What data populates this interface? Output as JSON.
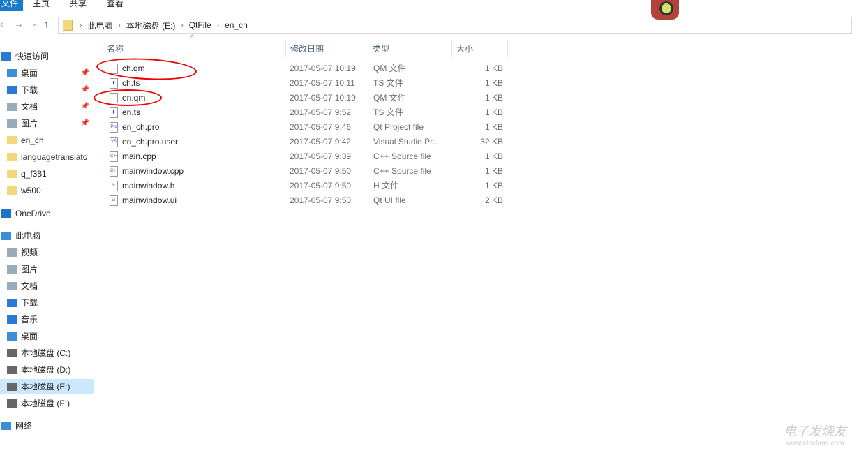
{
  "ribbon": {
    "tabs": [
      "文件",
      "主页",
      "共享",
      "查看"
    ]
  },
  "address": {
    "crumbs": [
      "此电脑",
      "本地磁盘 (E:)",
      "QtFile",
      "en_ch"
    ]
  },
  "sidebar": {
    "items": [
      {
        "label": "快速访问",
        "icon": "star-icon"
      },
      {
        "label": "桌面",
        "icon": "desktop-icon",
        "pinned": true
      },
      {
        "label": "下载",
        "icon": "download-icon",
        "pinned": true
      },
      {
        "label": "文档",
        "icon": "document-icon",
        "pinned": true
      },
      {
        "label": "图片",
        "icon": "picture-icon",
        "pinned": true
      },
      {
        "label": "en_ch",
        "icon": "folder-icon"
      },
      {
        "label": "languagetranslatc",
        "icon": "folder-icon"
      },
      {
        "label": "q_f381",
        "icon": "folder-icon"
      },
      {
        "label": "w500",
        "icon": "folder-icon"
      },
      {
        "label": "OneDrive",
        "icon": "cloud-icon"
      },
      {
        "label": "此电脑",
        "icon": "computer-icon"
      },
      {
        "label": "视频",
        "icon": "video-icon"
      },
      {
        "label": "图片",
        "icon": "picture-icon"
      },
      {
        "label": "文档",
        "icon": "document-icon"
      },
      {
        "label": "下载",
        "icon": "download-icon"
      },
      {
        "label": "音乐",
        "icon": "music-icon"
      },
      {
        "label": "桌面",
        "icon": "desktop-icon"
      },
      {
        "label": "本地磁盘 (C:)",
        "icon": "drive-icon"
      },
      {
        "label": "本地磁盘 (D:)",
        "icon": "drive-icon"
      },
      {
        "label": "本地磁盘 (E:)",
        "icon": "drive-icon",
        "selected": true
      },
      {
        "label": "本地磁盘 (F:)",
        "icon": "drive-icon"
      },
      {
        "label": "网络",
        "icon": "network-icon"
      }
    ]
  },
  "columns": [
    "名称",
    "修改日期",
    "类型",
    "大小"
  ],
  "files": [
    {
      "name": "ch.qm",
      "date": "2017-05-07 10:19",
      "type": "QM 文件",
      "size": "1 KB",
      "ico": ""
    },
    {
      "name": "ch.ts",
      "date": "2017-05-07 10:11",
      "type": "TS 文件",
      "size": "1 KB",
      "ico": "▮"
    },
    {
      "name": "en.qm",
      "date": "2017-05-07 10:19",
      "type": "QM 文件",
      "size": "1 KB",
      "ico": ""
    },
    {
      "name": "en.ts",
      "date": "2017-05-07 9:52",
      "type": "TS 文件",
      "size": "1 KB",
      "ico": "▮"
    },
    {
      "name": "en_ch.pro",
      "date": "2017-05-07 9:46",
      "type": "Qt Project file",
      "size": "1 KB",
      "ico": "Pro"
    },
    {
      "name": "en_ch.pro.user",
      "date": "2017-05-07 9:42",
      "type": "Visual Studio Pr...",
      "size": "32 KB",
      "ico": "VS"
    },
    {
      "name": "main.cpp",
      "date": "2017-05-07 9:39",
      "type": "C++ Source file",
      "size": "1 KB",
      "ico": "C++"
    },
    {
      "name": "mainwindow.cpp",
      "date": "2017-05-07 9:50",
      "type": "C++ Source file",
      "size": "1 KB",
      "ico": "C++"
    },
    {
      "name": "mainwindow.h",
      "date": "2017-05-07 9:50",
      "type": "H 文件",
      "size": "1 KB",
      "ico": "✎"
    },
    {
      "name": "mainwindow.ui",
      "date": "2017-05-07 9:50",
      "type": "Qt UI file",
      "size": "2 KB",
      "ico": "ui"
    }
  ],
  "watermark": {
    "title": "电子发烧友",
    "url": "www.elecfans.com"
  }
}
